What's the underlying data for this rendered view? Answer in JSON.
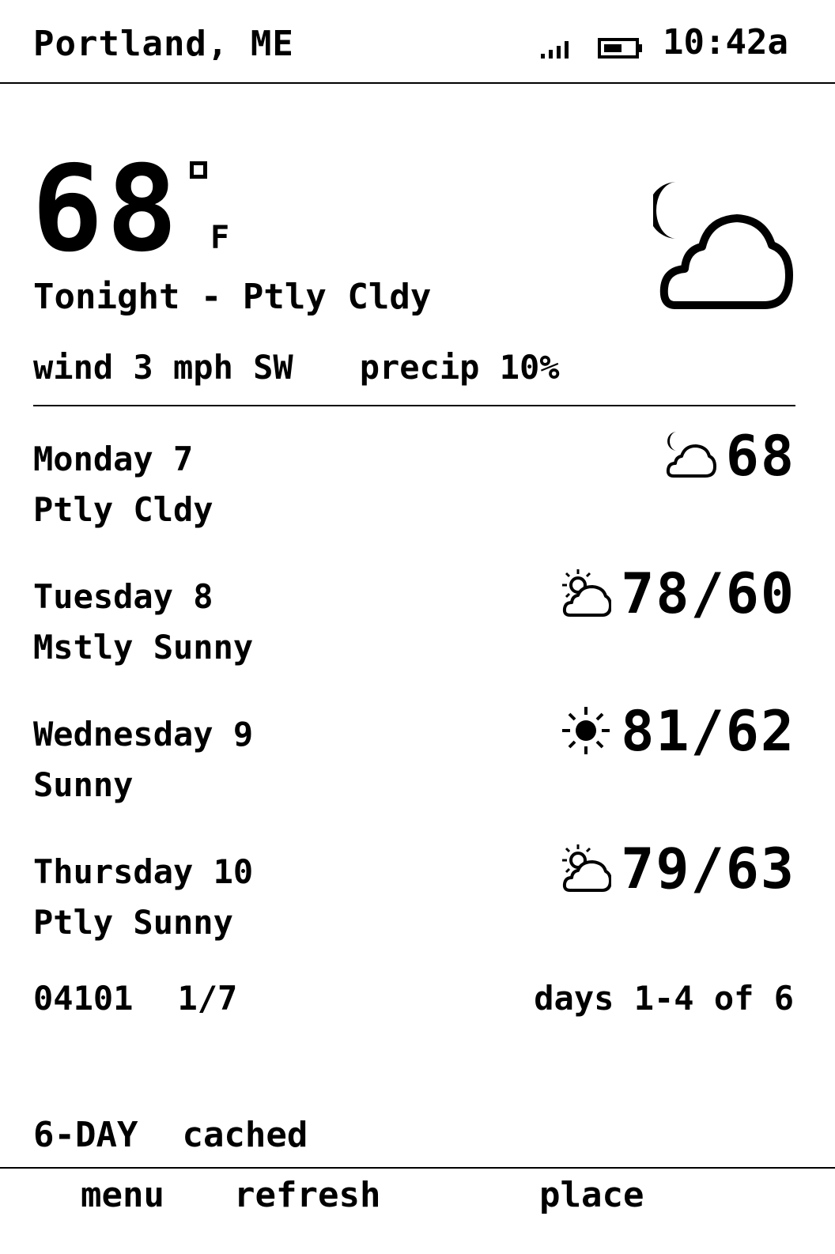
{
  "status": {
    "location": "Portland, ME",
    "time": "10:42a",
    "signal_icon": "signal-bars-icon",
    "battery_icon": "battery-icon"
  },
  "current": {
    "temp": "68",
    "unit": "F",
    "condition": "Tonight - Ptly Cldy",
    "wind": "wind 3 mph SW",
    "precip": "precip 10%",
    "icon": "night-partly-cloudy-icon"
  },
  "forecast": [
    {
      "day": "Monday 7",
      "condition": "Ptly Cldy",
      "temps": "68",
      "icon": "night-partly-cloudy-icon"
    },
    {
      "day": "Tuesday 8",
      "condition": "Mstly Sunny",
      "temps": "78/60",
      "icon": "partly-sunny-icon"
    },
    {
      "day": "Wednesday 9",
      "condition": "Sunny",
      "temps": "81/62",
      "icon": "sun-icon"
    },
    {
      "day": "Thursday 10",
      "condition": "Ptly Sunny",
      "temps": "79/63",
      "icon": "partly-sunny-icon"
    }
  ],
  "footer": {
    "zip": "04101",
    "page": "1/7",
    "range": "days 1-4 of 6"
  },
  "mode": {
    "label": "6-DAY",
    "state": "cached"
  },
  "softkeys": {
    "left": "menu",
    "center": "refresh",
    "right": "place"
  }
}
